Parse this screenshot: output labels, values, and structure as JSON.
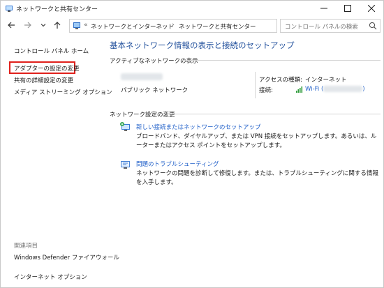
{
  "window": {
    "title": "ネットワークと共有センター"
  },
  "nav": {
    "breadcrumbs": [
      "ネットワークとインターネット",
      "ネットワークと共有センター"
    ],
    "search_placeholder": "コントロール パネルの検索"
  },
  "left_pane": {
    "home": "コントロール パネル ホーム",
    "items": [
      "アダプターの設定の変更",
      "共有の詳細設定の変更",
      "メディア ストリーミング オプション"
    ],
    "related_title": "関連項目",
    "related": [
      "Windows Defender ファイアウォール",
      "インターネット オプション"
    ]
  },
  "main": {
    "title": "基本ネットワーク情報の表示と接続のセットアップ",
    "active_networks_head": "アクティブなネットワークの表示",
    "network_type": "パブリック ネットワーク",
    "access_type_label": "アクセスの種類:",
    "access_type_value": "インターネット",
    "connection_label": "接続:",
    "connection_value_prefix": "Wi-Fi (",
    "connection_value_suffix": ")",
    "settings_head": "ネットワーク設定の変更",
    "tasks": [
      {
        "link": "新しい接続またはネットワークのセットアップ",
        "desc": "ブロードバンド、ダイヤルアップ、または VPN 接続をセットアップします。あるいは、ルーターまたはアクセス ポイントをセットアップします。"
      },
      {
        "link": "問題のトラブルシューティング",
        "desc": "ネットワークの問題を診断して修復します。または、トラブルシューティングに関する情報を入手します。"
      }
    ]
  },
  "colors": {
    "link": "#1f5fc9",
    "title": "#1f4e9b",
    "highlight": "#e0201b"
  }
}
